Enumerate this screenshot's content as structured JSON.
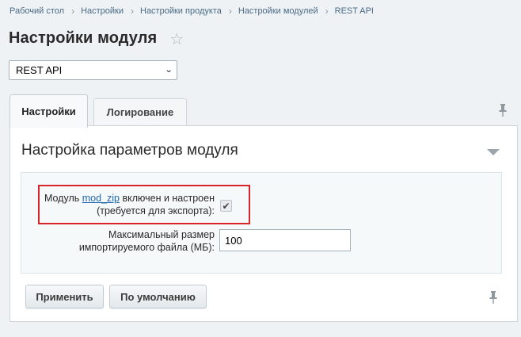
{
  "breadcrumb": [
    "Рабочий стол",
    "Настройки",
    "Настройки продукта",
    "Настройки модулей",
    "REST API"
  ],
  "page": {
    "title": "Настройки модуля",
    "favorite_icon": "star-outline-icon"
  },
  "module_select": {
    "selected": "REST API"
  },
  "tabs": [
    {
      "label": "Настройки",
      "active": true
    },
    {
      "label": "Логирование",
      "active": false
    }
  ],
  "section": {
    "title": "Настройка параметров модуля",
    "fields": [
      {
        "label_prefix": "Модуль ",
        "label_link": "mod_zip",
        "label_suffix": " включен и настроен",
        "label_line2": "(требуется для экспорта):",
        "checked": true
      },
      {
        "label_line1": "Максимальный размер",
        "label_line2": "импортируемого файла (МБ):",
        "value": "100"
      }
    ]
  },
  "buttons": {
    "apply": "Применить",
    "default": "По умолчанию"
  },
  "colors": {
    "highlight": "#d8252b",
    "link": "#2067b0"
  }
}
